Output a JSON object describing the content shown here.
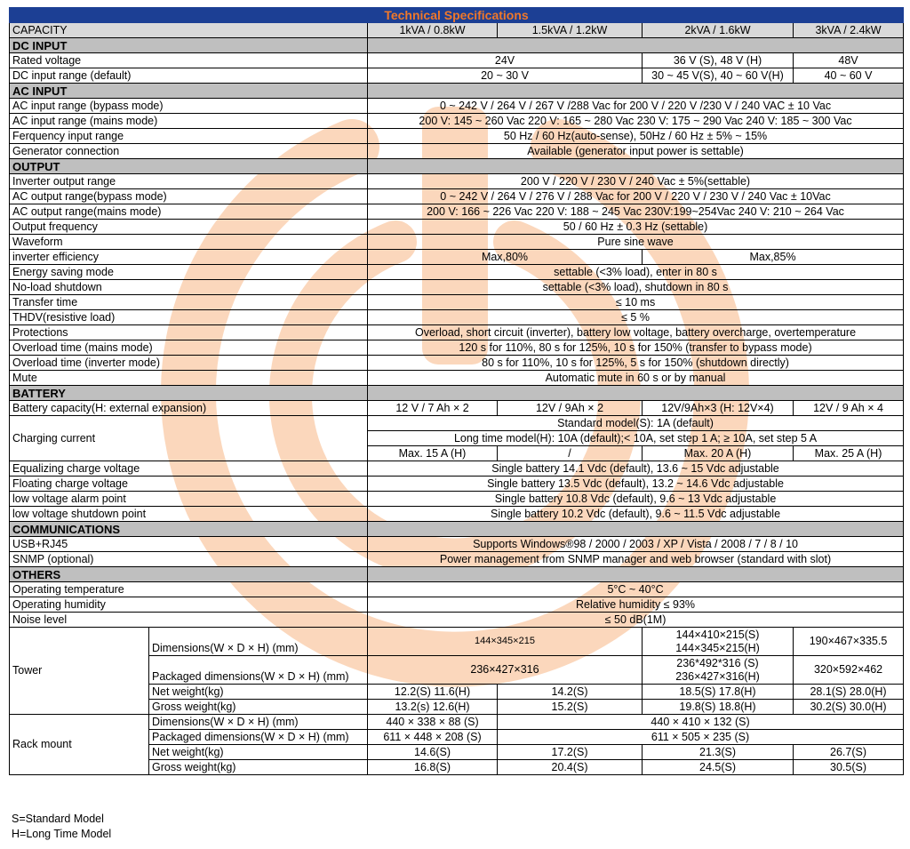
{
  "title": "Technical Specifications",
  "capacity": {
    "label": "CAPACITY",
    "models": [
      "1kVA / 0.8kW",
      "1.5kVA / 1.2kW",
      "2kVA / 1.6kW",
      "3kVA / 2.4kW"
    ]
  },
  "dc_input": {
    "heading": "DC INPUT",
    "rated_voltage": {
      "label": "Rated voltage",
      "v1": "24V",
      "v2": "36 V (S), 48 V (H)",
      "v3": "48V"
    },
    "input_range": {
      "label": "DC input range (default)",
      "v1": "20 ~ 30 V",
      "v2": "30 ~ 45 V(S), 40 ~ 60 V(H)",
      "v3": "40 ~ 60 V"
    }
  },
  "ac_input": {
    "heading": "AC INPUT",
    "rows": [
      {
        "label": "AC input range (bypass mode)",
        "value": "0 ~ 242 V / 264 V / 267 V /288 Vac for 200 V / 220 V /230 V / 240 VAC ± 10 Vac"
      },
      {
        "label": "AC input range (mains mode)",
        "value": "200 V: 145 ~ 260 Vac 220 V: 165 ~ 280 Vac 230 V: 175 ~ 290 Vac 240 V: 185 ~ 300 Vac"
      },
      {
        "label": "Ferquency input range",
        "value": "50 Hz / 60 Hz(auto-sense), 50Hz / 60 Hz ± 5% ~ 15%"
      },
      {
        "label": "Generator connection",
        "value": "Available (generator input power is settable)"
      }
    ]
  },
  "output": {
    "heading": "OUTPUT",
    "rows_a": [
      {
        "label": "Inverter output range",
        "value": "200 V / 220 V / 230 V / 240 Vac ± 5%(settable)"
      },
      {
        "label": "AC output range(bypass mode)",
        "value": "0 ~ 242 V / 264 V / 276 V / 288 Vac for 200 V / 220 V / 230 V / 240 Vac ± 10Vac"
      },
      {
        "label": "AC output range(mains mode)",
        "value": "200 V: 166 ~ 226 Vac 220 V: 188 ~ 245 Vac 230V:199~254Vac  240 V: 210 ~ 264 Vac"
      },
      {
        "label": "Output frequency",
        "value": "50 / 60 Hz ± 0.3 Hz (settable)"
      },
      {
        "label": "Waveform",
        "value": "Pure sine wave"
      }
    ],
    "efficiency": {
      "label": "inverter efficiency",
      "v1": "Max,80%",
      "v2": "Max,85%"
    },
    "rows_b": [
      {
        "label": "Energy saving mode",
        "value": "settable (<3% load), enter in 80 s"
      },
      {
        "label": "No-load shutdown",
        "value": "settable (<3% load), shutdown in 80 s"
      },
      {
        "label": "Transfer time",
        "value": "≤ 10 ms"
      },
      {
        "label": "THDV(resistive load)",
        "value": "≤ 5 %"
      },
      {
        "label": "Protections",
        "value": "Overload, short circuit (inverter), battery low voltage, battery overcharge, overtemperature"
      },
      {
        "label": "Overload time (mains mode)",
        "value": "120 s for 110%, 80 s for 125%, 10 s for 150% (transfer to bypass mode)"
      },
      {
        "label": "Overload time (inverter mode)",
        "value": "80 s for 110%, 10 s for 125%, 5 s for 150% (shutdown directly)"
      },
      {
        "label": "Mute",
        "value": "Automatic mute in 60 s or by manual"
      }
    ]
  },
  "battery": {
    "heading": "BATTERY",
    "capacity": {
      "label": "Battery capacity(H: external expansion)",
      "values": [
        "12 V / 7 Ah × 2",
        "12V / 9Ah × 2",
        "12V/9Ah×3 (H: 12V×4)",
        "12V / 9 Ah × 4"
      ]
    },
    "charging": {
      "label": "Charging current",
      "standard": "Standard model(S): 1A (default)",
      "long": "Long time model(H): 10A (default);< 10A, set step 1 A; ≥ 10A, set step 5 A",
      "values": [
        "Max. 15 A (H)",
        "/",
        "Max. 20 A (H)",
        "Max. 25 A (H)"
      ]
    },
    "rows": [
      {
        "label": "Equalizing charge voltage",
        "value": "Single battery 14.1 Vdc (default), 13.6 ~ 15 Vdc adjustable"
      },
      {
        "label": "Floating charge voltage",
        "value": "Single battery 13.5 Vdc (default), 13.2 ~ 14.6 Vdc adjustable"
      },
      {
        "label": "low voltage alarm point",
        "value": "Single battery 10.8 Vdc (default), 9.6 ~ 13 Vdc adjustable"
      },
      {
        "label": "low voltage shutdown  point",
        "value": "Single battery 10.2 Vdc (default), 9.6 ~ 11.5 Vdc adjustable"
      }
    ]
  },
  "communications": {
    "heading": "COMMUNICATIONS",
    "rows": [
      {
        "label": "USB+RJ45",
        "value": "Supports Windows®98 / 2000 / 2003 / XP / Vista / 2008 / 7 / 8 / 10"
      },
      {
        "label": "SNMP (optional)",
        "value": "Power management from SNMP manager and web browser (standard with slot)"
      }
    ]
  },
  "others": {
    "heading": "OTHERS",
    "rows": [
      {
        "label": "Operating temperature",
        "value": "5°C ~ 40°C"
      },
      {
        "label": "Operating humidity",
        "value": "Relative humidity ≤ 93%"
      },
      {
        "label": "Noise level",
        "value": "≤ 50 dB(1M)"
      }
    ]
  },
  "tower": {
    "label": "Tower",
    "dimensions": {
      "label": "Dimensions(W × D × H) (mm)",
      "v1": "144×345×215",
      "v2a": "144×410×215(S)",
      "v2b": "144×345×215(H)",
      "v3": "190×467×335.5"
    },
    "packaged": {
      "label": "Packaged dimensions(W × D × H) (mm)",
      "v1": "236×427×316",
      "v2a": "236*492*316 (S)",
      "v2b": "236×427×316(H)",
      "v3": "320×592×462"
    },
    "net": {
      "label": "Net weight(kg)",
      "values": [
        "12.2(S) 11.6(H)",
        "14.2(S)",
        "18.5(S) 17.8(H)",
        "28.1(S) 28.0(H)"
      ]
    },
    "gross": {
      "label": "Gross weight(kg)",
      "values": [
        "13.2(s) 12.6(H)",
        "15.2(S)",
        "19.8(S) 18.8(H)",
        "30.2(S) 30.0(H)"
      ]
    }
  },
  "rack": {
    "label": "Rack mount",
    "dimensions": {
      "label": "Dimensions(W × D × H) (mm)",
      "v1": "440 × 338 × 88 (S)",
      "v2": "440 × 410 × 132 (S)"
    },
    "packaged": {
      "label": "Packaged dimensions(W × D × H) (mm)",
      "v1": "611 × 448 × 208 (S)",
      "v2": "611 × 505 × 235 (S)"
    },
    "net": {
      "label": "Net weight(kg)",
      "values": [
        "14.6(S)",
        "17.2(S)",
        "21.3(S)",
        "26.7(S)"
      ]
    },
    "gross": {
      "label": "Gross weight(kg)",
      "values": [
        "16.8(S)",
        "20.4(S)",
        "24.5(S)",
        "30.5(S)"
      ]
    }
  },
  "footnotes": [
    "S=Standard Model",
    "H=Long Time Model"
  ],
  "colors": {
    "header_bg": "#1c3f94",
    "header_text": "#f0782a",
    "section_bg": "#bfbfbf",
    "watermark": "#f6a060"
  },
  "watermark_icon": "power-logo-icon"
}
